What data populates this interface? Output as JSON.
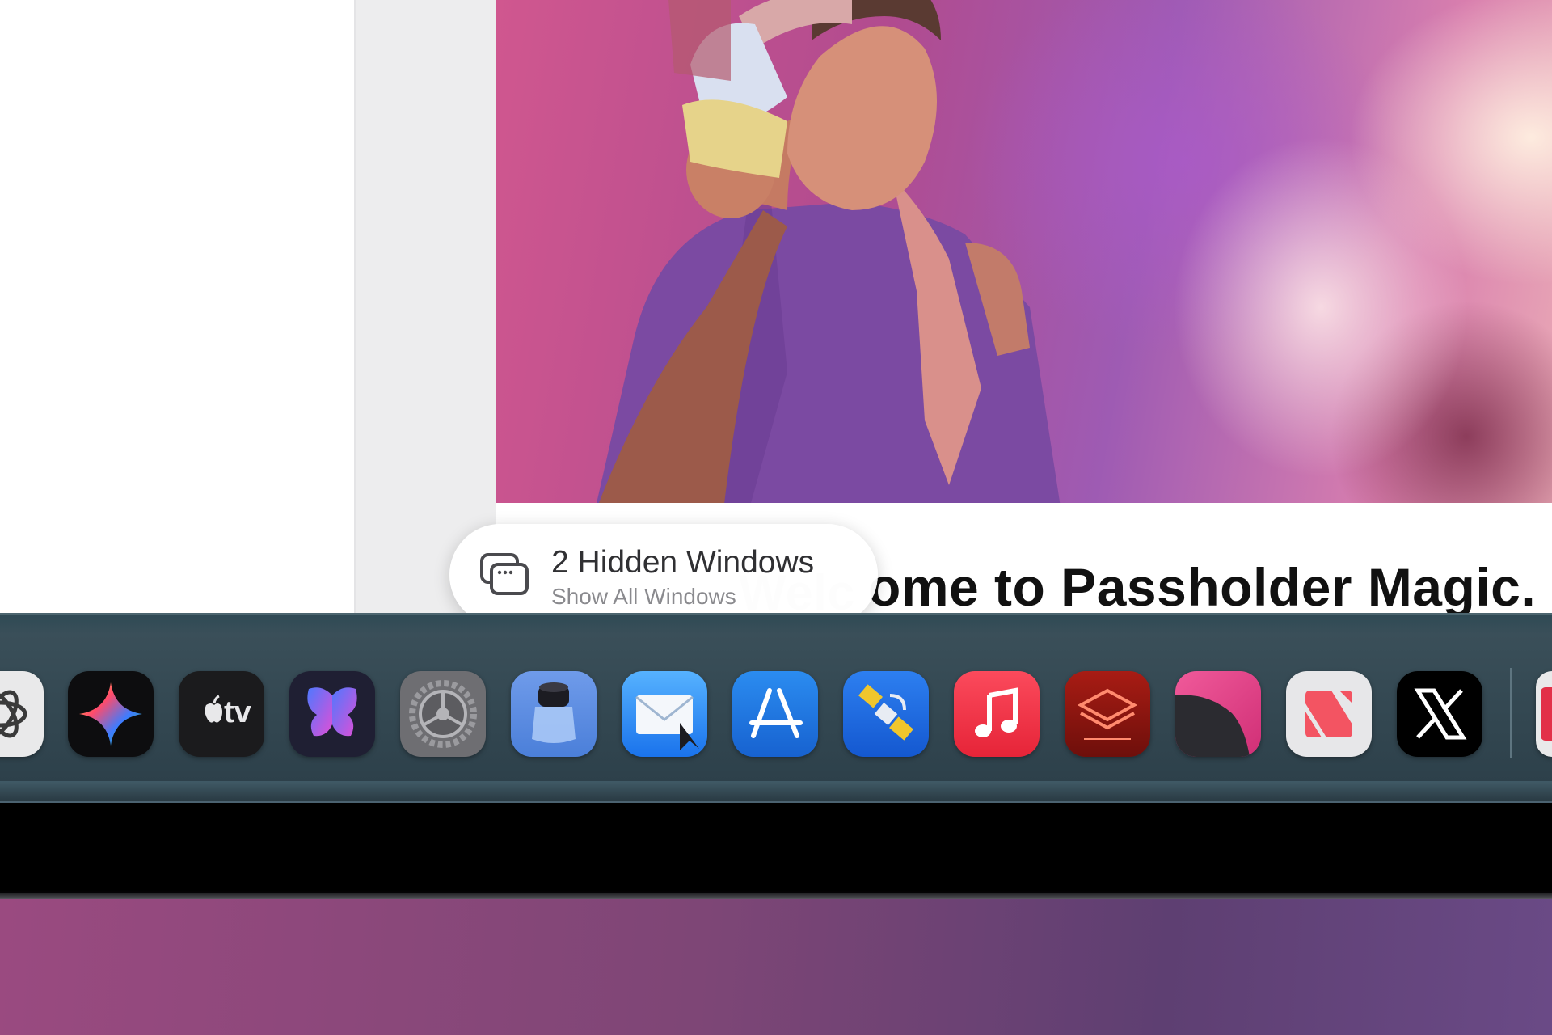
{
  "article": {
    "headline": "Welcome to Passholder Magic.",
    "headline_visible": "ome to Passholder Magic."
  },
  "hidden_windows_popup": {
    "title": "2 Hidden Windows",
    "subtitle": "Show All Windows",
    "icon": "windows-stack-icon"
  },
  "dock": {
    "apps": [
      {
        "name": "ChatGPT",
        "icon": "chatgpt-icon",
        "color": "#e9e9ea"
      },
      {
        "name": "Gemini",
        "icon": "gemini-icon",
        "color": "#0d0d0f"
      },
      {
        "name": "Apple TV",
        "icon": "apple-tv-icon",
        "color": "#1b1b1d"
      },
      {
        "name": "Butterfly",
        "icon": "butterfly-icon",
        "color": "#1f1f33"
      },
      {
        "name": "System Settings",
        "icon": "gear-icon",
        "color": "#6e6e72"
      },
      {
        "name": "Magnifier",
        "icon": "magnifier-icon",
        "color": "#5b8ee6"
      },
      {
        "name": "Mail",
        "icon": "mail-icon",
        "color": "#2f8ef5"
      },
      {
        "name": "App Store",
        "icon": "app-store-icon",
        "color": "#1f7ae0"
      },
      {
        "name": "Satellite",
        "icon": "satellite-icon",
        "color": "#1a64d8"
      },
      {
        "name": "Music",
        "icon": "music-icon",
        "color": "#f23447"
      },
      {
        "name": "Layers",
        "icon": "layers-icon",
        "color": "#8a1410"
      },
      {
        "name": "Screens",
        "icon": "screens-icon",
        "color": "#e23e86"
      },
      {
        "name": "News",
        "icon": "news-icon",
        "color": "#e7e7e9"
      },
      {
        "name": "X",
        "icon": "x-icon",
        "color": "#000000"
      }
    ],
    "apple_tv_label": "tv"
  }
}
